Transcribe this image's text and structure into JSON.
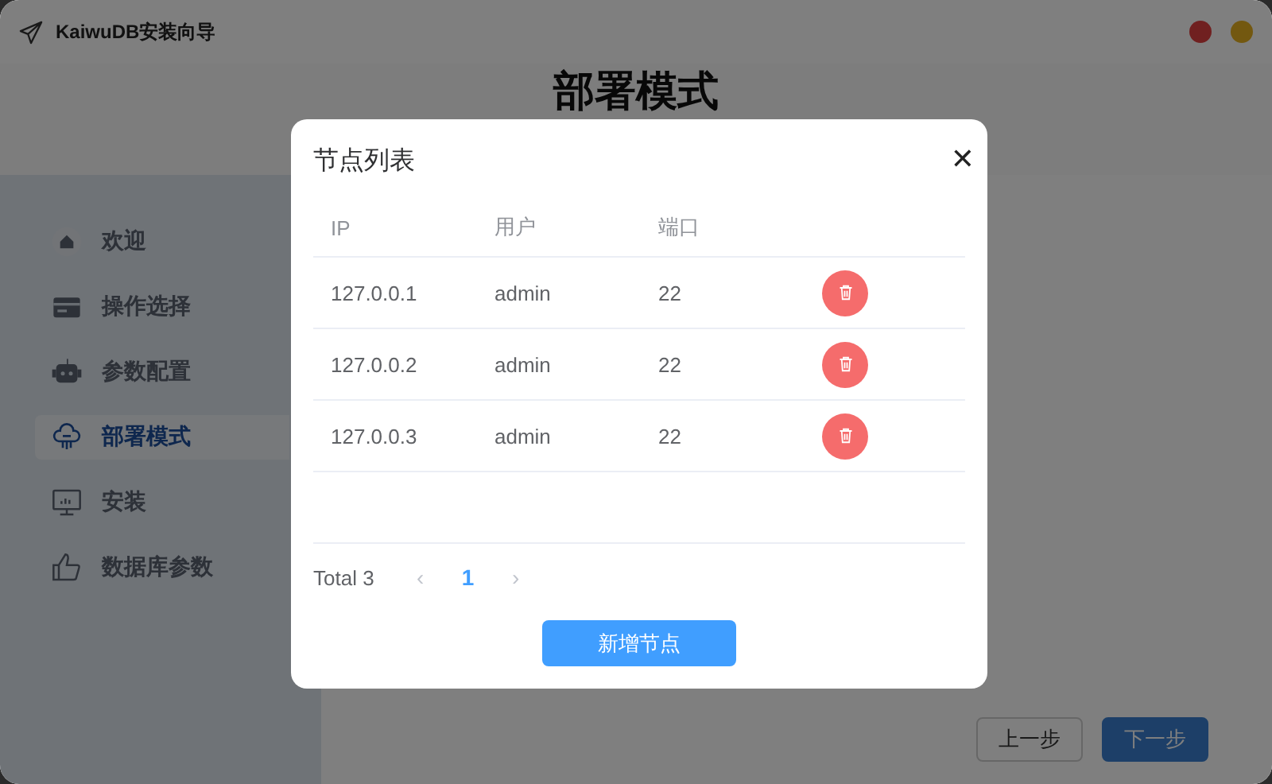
{
  "window": {
    "title": "KaiwuDB安装向导"
  },
  "page": {
    "heading": "部署模式"
  },
  "sidebar": {
    "items": [
      {
        "label": "欢迎",
        "selected": false
      },
      {
        "label": "操作选择",
        "selected": false
      },
      {
        "label": "参数配置",
        "selected": false
      },
      {
        "label": "部署模式",
        "selected": true
      },
      {
        "label": "安装",
        "selected": false
      },
      {
        "label": "数据库参数",
        "selected": false
      }
    ]
  },
  "footer": {
    "buttons": [
      {
        "label": "上一步",
        "kind": "plain"
      },
      {
        "label": "下一步",
        "kind": "primary"
      }
    ]
  },
  "dialog": {
    "title": "节点列表",
    "close": "✕",
    "table": {
      "columns": [
        "IP",
        "用户",
        "端口"
      ],
      "rows": [
        {
          "ip": "127.0.0.1",
          "user": "admin",
          "port": "22"
        },
        {
          "ip": "127.0.0.2",
          "user": "admin",
          "port": "22"
        },
        {
          "ip": "127.0.0.3",
          "user": "admin",
          "port": "22"
        }
      ]
    },
    "pagination": {
      "total": "Total 3",
      "prev": "‹",
      "pages": [
        {
          "label": "1",
          "selected": true
        }
      ],
      "next": "›"
    },
    "button": "新增节点"
  }
}
